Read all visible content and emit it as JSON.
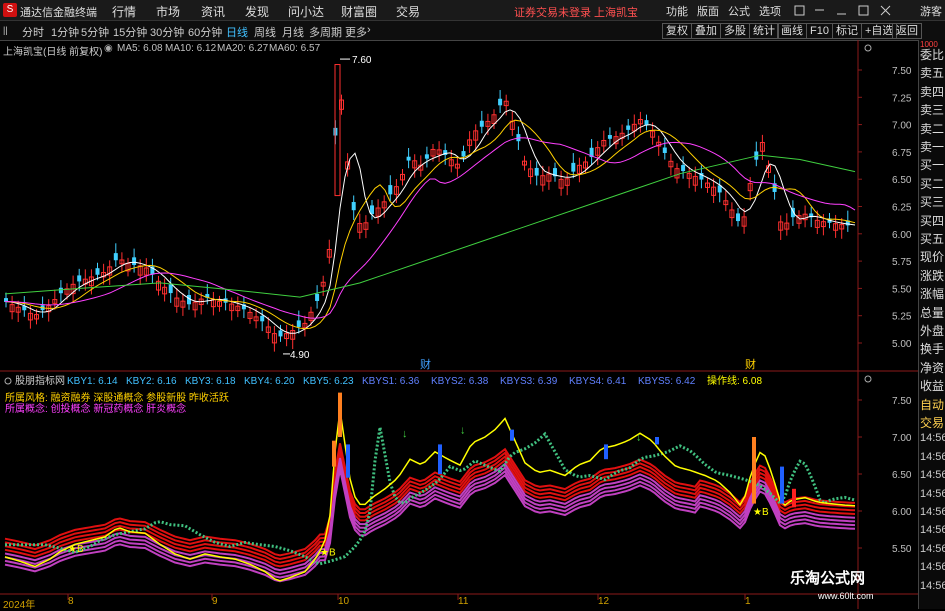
{
  "app": {
    "name": "通达信金融终端",
    "logo": "S"
  },
  "menu": [
    "行情",
    "市场",
    "资讯",
    "发现",
    "问小达",
    "财富圈",
    "交易"
  ],
  "notice": "证券交易未登录  上海凯宝",
  "right_menu": [
    "功能",
    "版面",
    "公式",
    "选项"
  ],
  "user": "游客",
  "periods": [
    "分时",
    "1分钟",
    "5分钟",
    "15分钟",
    "30分钟",
    "60分钟",
    "日线",
    "周线",
    "月线",
    "多周期",
    "更多"
  ],
  "active_period": "日线",
  "right_buttons": [
    "复权",
    "叠加",
    "多股",
    "统计",
    "画线",
    "F10",
    "标记",
    "+自选",
    "返回"
  ],
  "chart_title": "上海凯宝(日线 前复权)",
  "ma": [
    {
      "label": "MA5: 6.08",
      "color": "#ffffff"
    },
    {
      "label": "MA10: 6.12",
      "color": "#ffd000"
    },
    {
      "label": "MA20: 6.27",
      "color": "#ff40ff"
    },
    {
      "label": "MA60: 6.57",
      "color": "#40d040"
    }
  ],
  "price_ticks": [
    "7.50",
    "7.25",
    "7.00",
    "6.75",
    "6.50",
    "6.25",
    "6.00",
    "5.75",
    "5.50",
    "5.25",
    "5.00"
  ],
  "high_label": "7.60",
  "low_label": "4.90",
  "markers": [
    "财",
    "财"
  ],
  "indicator": {
    "name": "股朋指标网",
    "values": [
      {
        "label": "KBY1: 6.14",
        "color": "#40c0ff"
      },
      {
        "label": "KBY2: 6.16",
        "color": "#40c0ff"
      },
      {
        "label": "KBY3: 6.18",
        "color": "#40c0ff"
      },
      {
        "label": "KBY4: 6.20",
        "color": "#40c0ff"
      },
      {
        "label": "KBY5: 6.23",
        "color": "#40c0ff"
      },
      {
        "label": "KBYS1: 6.36",
        "color": "#6080ff"
      },
      {
        "label": "KBYS2: 6.38",
        "color": "#6080ff"
      },
      {
        "label": "KBYS3: 6.39",
        "color": "#6080ff"
      },
      {
        "label": "KBYS4: 6.41",
        "color": "#6080ff"
      },
      {
        "label": "KBYS5: 6.42",
        "color": "#6080ff"
      },
      {
        "label": "操作线: 6.08",
        "color": "#ffff00"
      }
    ],
    "style": "所属风格:  融资融券 深股通概念 参股新股 昨收活跃",
    "concept": "所属概念:  创投概念 新冠药概念 肝炎概念",
    "ticks": [
      "7.50",
      "7.00",
      "6.50",
      "6.00",
      "5.50"
    ],
    "buy_label": "B"
  },
  "sidebar": [
    "委比",
    "卖五",
    "卖四",
    "卖三",
    "卖二",
    "卖一",
    "买一",
    "买二",
    "买三",
    "买四",
    "买五",
    "现价",
    "涨跌",
    "涨幅",
    "总量",
    "外盘",
    "换手",
    "净资",
    "收益",
    "自动",
    "交易",
    "14:56",
    "14:56",
    "14:56",
    "14:56",
    "14:56",
    "14:56",
    "14:56",
    "14:56",
    "14:56"
  ],
  "side_top": "1000",
  "x_labels": [
    "2024年",
    "8",
    "9",
    "10",
    "11",
    "12",
    "1"
  ],
  "watermark": {
    "line1": "乐淘公式网",
    "line2": "www.60lt.com"
  }
}
